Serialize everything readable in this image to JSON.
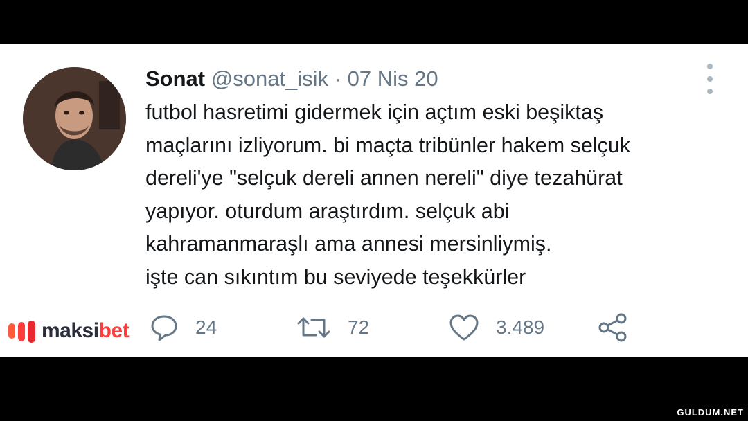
{
  "tweet": {
    "name": "Sonat",
    "handle": "@sonat_isik",
    "separator": "·",
    "date": "07 Nis 20",
    "lines": [
      "futbol hasretimi gidermek için açtım eski beşiktaş",
      "maçlarını izliyorum. bi maçta tribünler hakem selçuk",
      "dereli'ye \"selçuk dereli annen nereli\" diye tezahürat",
      "yapıyor. oturdum araştırdım. selçuk abi",
      "kahramanmaraşlı ama annesi mersinliymiş.",
      "işte can sıkıntım bu seviyede teşekkürler"
    ],
    "actions": {
      "replies": "24",
      "retweets": "72",
      "likes": "3.489"
    }
  },
  "brand": {
    "part1": "maksi",
    "part2": "bet"
  },
  "watermark": "GULDUM.NET",
  "icons": [
    "more-icon",
    "reply-icon",
    "retweet-icon",
    "like-icon",
    "share-icon",
    "maksibet-logo-icon"
  ],
  "colors": {
    "background_bars": "#000000",
    "card": "#ffffff",
    "text": "#14171a",
    "muted": "#657786",
    "brand_accent": "#ff3d3d"
  }
}
